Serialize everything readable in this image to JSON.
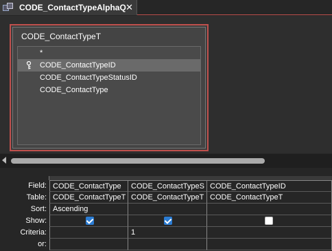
{
  "tab": {
    "title": "CODE_ContactTypeAlphaQ",
    "icon": "query-icon",
    "close": "✕"
  },
  "table": {
    "name": "CODE_ContactTypeT",
    "fields": [
      {
        "name": "*",
        "primary_key": false,
        "selected": false
      },
      {
        "name": "CODE_ContactTypeID",
        "primary_key": true,
        "selected": true
      },
      {
        "name": "CODE_ContactTypeStatusID",
        "primary_key": false,
        "selected": false
      },
      {
        "name": "CODE_ContactType",
        "primary_key": false,
        "selected": false
      }
    ]
  },
  "grid": {
    "row_labels": {
      "field": "Field:",
      "table": "Table:",
      "sort": "Sort:",
      "show": "Show:",
      "criteria": "Criteria:",
      "or": "or:"
    },
    "columns": [
      {
        "field": "CODE_ContactType",
        "table": "CODE_ContactTypeT",
        "sort": "Ascending",
        "show": true,
        "criteria": "",
        "or": ""
      },
      {
        "field": "CODE_ContactTypeS",
        "table": "CODE_ContactTypeT",
        "sort": "",
        "show": true,
        "criteria": "1",
        "or": ""
      },
      {
        "field": "CODE_ContactTypeID",
        "table": "CODE_ContactTypeT",
        "sort": "",
        "show": false,
        "criteria": "",
        "or": ""
      }
    ]
  },
  "colors": {
    "active_border": "#c0504d",
    "checkbox_checked": "#2b7cd3",
    "background": "#262626"
  }
}
